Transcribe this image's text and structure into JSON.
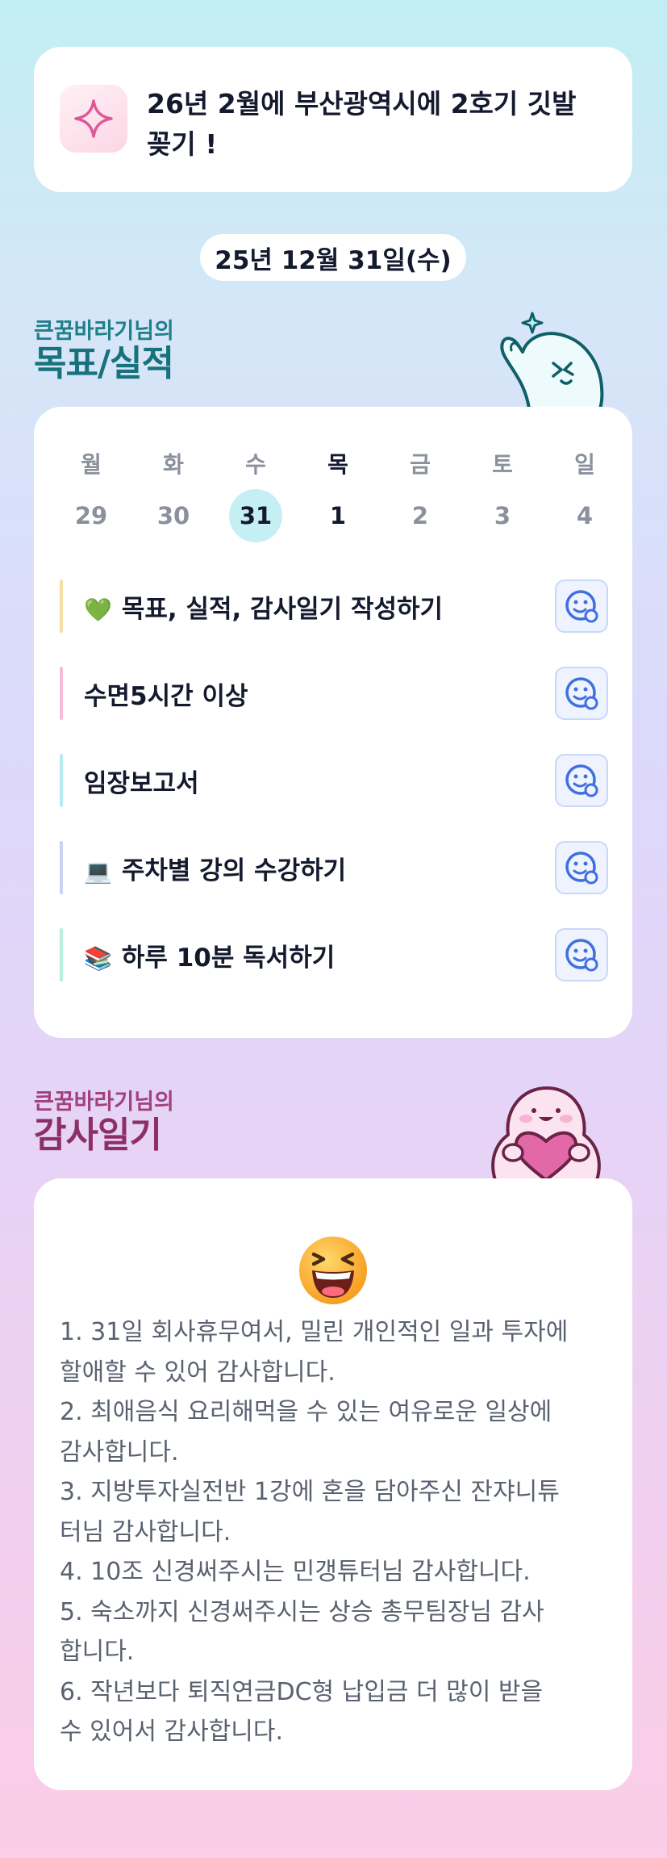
{
  "goal_banner": {
    "text": "26년 2월에 부산광역시에 2호기 깃발꽂기 !",
    "icon": "sparkle-icon"
  },
  "date_label": "25년 12월 31일(수)",
  "goals_section": {
    "subtitle": "큰꿈바라기님의",
    "title": "목표/실적"
  },
  "calendar": {
    "weekdays": [
      "월",
      "화",
      "수",
      "목",
      "금",
      "토",
      "일"
    ],
    "days": [
      "29",
      "30",
      "31",
      "1",
      "2",
      "3",
      "4"
    ],
    "selected_day": "31"
  },
  "tasks": [
    {
      "emoji": "💚",
      "label": "목표, 실적, 감사일기 작성하기",
      "bar_color": "#f3dfa3"
    },
    {
      "emoji": "",
      "label": "수면5시간 이상",
      "bar_color": "#f6bcd8"
    },
    {
      "emoji": "",
      "label": "임장보고서",
      "bar_color": "#b6ecf0"
    },
    {
      "emoji": "💻",
      "label": "주차별 강의 수강하기",
      "bar_color": "#c8d3f5"
    },
    {
      "emoji": "📚",
      "label": "하루 10분 독서하기",
      "bar_color": "#b9ede0"
    }
  ],
  "diary_section": {
    "subtitle": "큰꿈바라기님의",
    "title": "감사일기"
  },
  "diary": {
    "emoji": "😆",
    "lines": [
      "1. 31일 회사휴무여서, 밀린 개인적인 일과 투자에",
      "할애할 수 있어 감사합니다.",
      "2. 최애음식 요리해먹을 수 있는 여유로운 일상에",
      "감사합니다.",
      "3. 지방투자실전반 1강에 혼을 담아주신 잔쟈니튜",
      "터님 감사합니다.",
      "4. 10조 신경써주시는 민갱튜터님 감사합니다.",
      "5. 숙소까지 신경써주시는 상승 총무팀장님 감사",
      "합니다.",
      "6. 작년보다 퇴직연금DC형 납입금 더 많이 받을",
      "수 있어서 감사합니다."
    ]
  },
  "colors": {
    "accent_teal": "#17727c",
    "accent_pink": "#8d2f66",
    "today_highlight": "#c6eff4",
    "emotion_button": "#3f6fe0"
  }
}
